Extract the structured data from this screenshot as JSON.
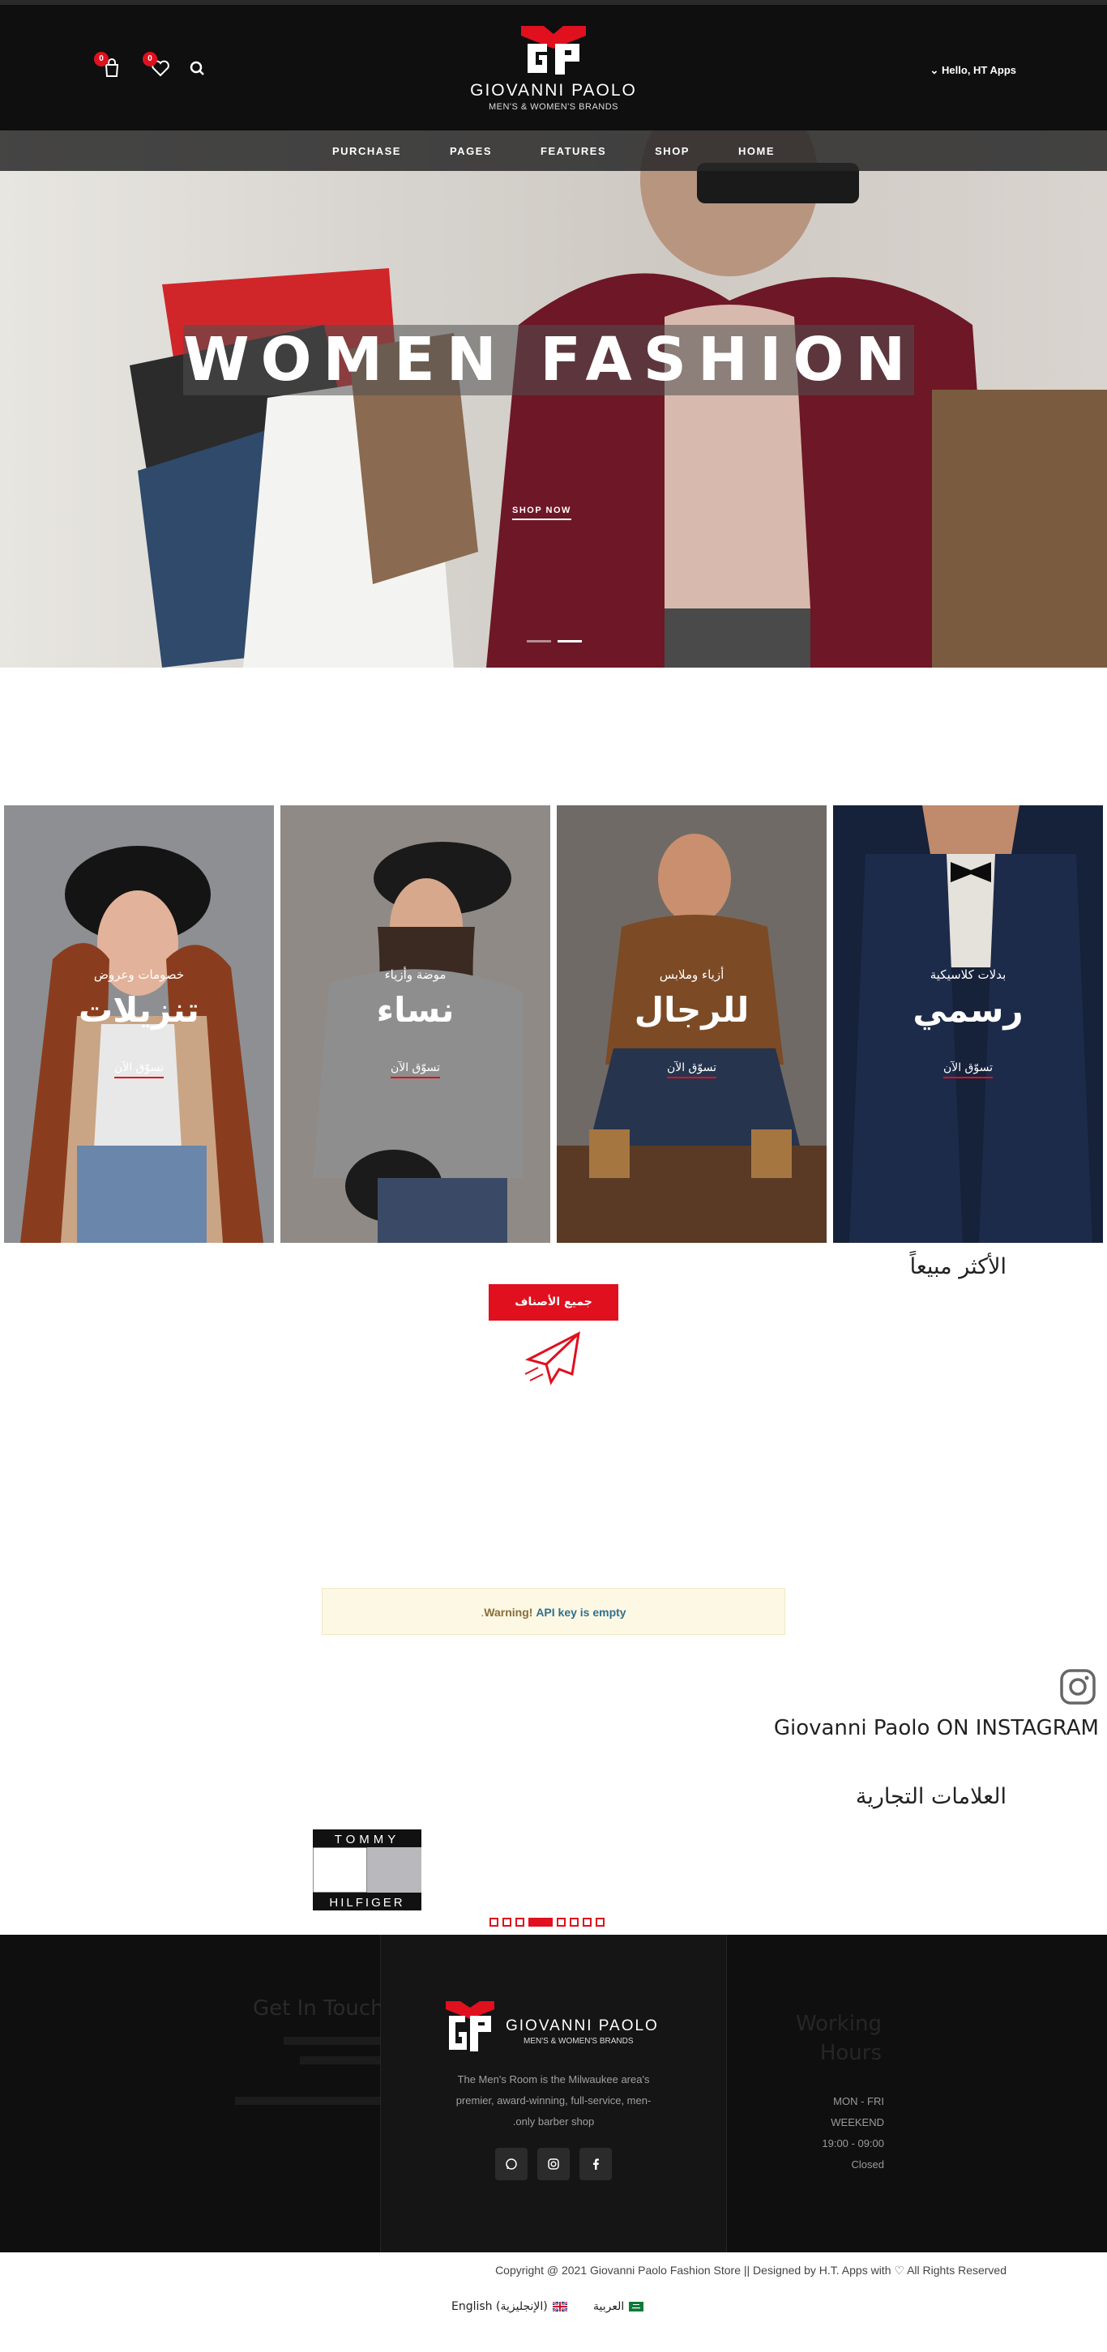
{
  "header": {
    "cart_count": "0",
    "wishlist_count": "0",
    "greeting": "Hello, HT Apps",
    "brand_name": "GIOVANNI PAOLO",
    "brand_tagline": "MEN'S & WOMEN'S BRANDS"
  },
  "nav": {
    "items": [
      "PURCHASE",
      "PAGES",
      "FEATURES",
      "SHOP",
      "HOME"
    ]
  },
  "hero": {
    "title": "WOMEN FASHION",
    "cta": "SHOP NOW",
    "slides": 2,
    "active_slide": 2
  },
  "categories": [
    {
      "subtitle": "خصومات وعروض",
      "title": "تنزيلات",
      "link": "تسوّق الآن"
    },
    {
      "subtitle": "موضة وأزياء",
      "title": "نساء",
      "link": "تسوّق الآن"
    },
    {
      "subtitle": "أزياء وملابس",
      "title": "للرجال",
      "link": "تسوّق الآن"
    },
    {
      "subtitle": "بدلات كلاسيكية",
      "title": "رسمي",
      "link": "تسوّق الآن"
    }
  ],
  "best_sellers": {
    "title": "الأكثر مبيعاً",
    "all_button": "جميع الأصناف"
  },
  "warning": {
    "prefix": "Warning!",
    "message": "API key is empty",
    "suffix": "."
  },
  "instagram": {
    "title": "Giovanni Paolo ON INSTAGRAM"
  },
  "brands": {
    "title": "العلامات التجارية",
    "logo_top": "TOMMY",
    "logo_bottom": "HILFIGER",
    "pages": 8,
    "active_page": 4
  },
  "footer": {
    "get_in_touch": "Get In Touch",
    "working_hours_line1": "Working",
    "working_hours_line2": "Hours",
    "hours": [
      "MON - FRI",
      "WEEKEND",
      "19:00 - 09:00",
      "Closed"
    ],
    "description": [
      "The Men's Room is the Milwaukee area's",
      "premier, award-winning, full-service, men-",
      ".only barber shop"
    ],
    "social": [
      "whatsapp-icon",
      "instagram-icon",
      "facebook-icon"
    ]
  },
  "bottom": {
    "copyright_left": "Copyright @ 2021 Giovanni Paolo Fashion Store || Designed by H.T. Apps with",
    "copyright_right": "All Rights Reserved",
    "lang_english": "English (الإنجليزية)",
    "lang_arabic": "العربية"
  },
  "colors": {
    "accent": "#e0101e",
    "dark": "#0f0f0f"
  }
}
